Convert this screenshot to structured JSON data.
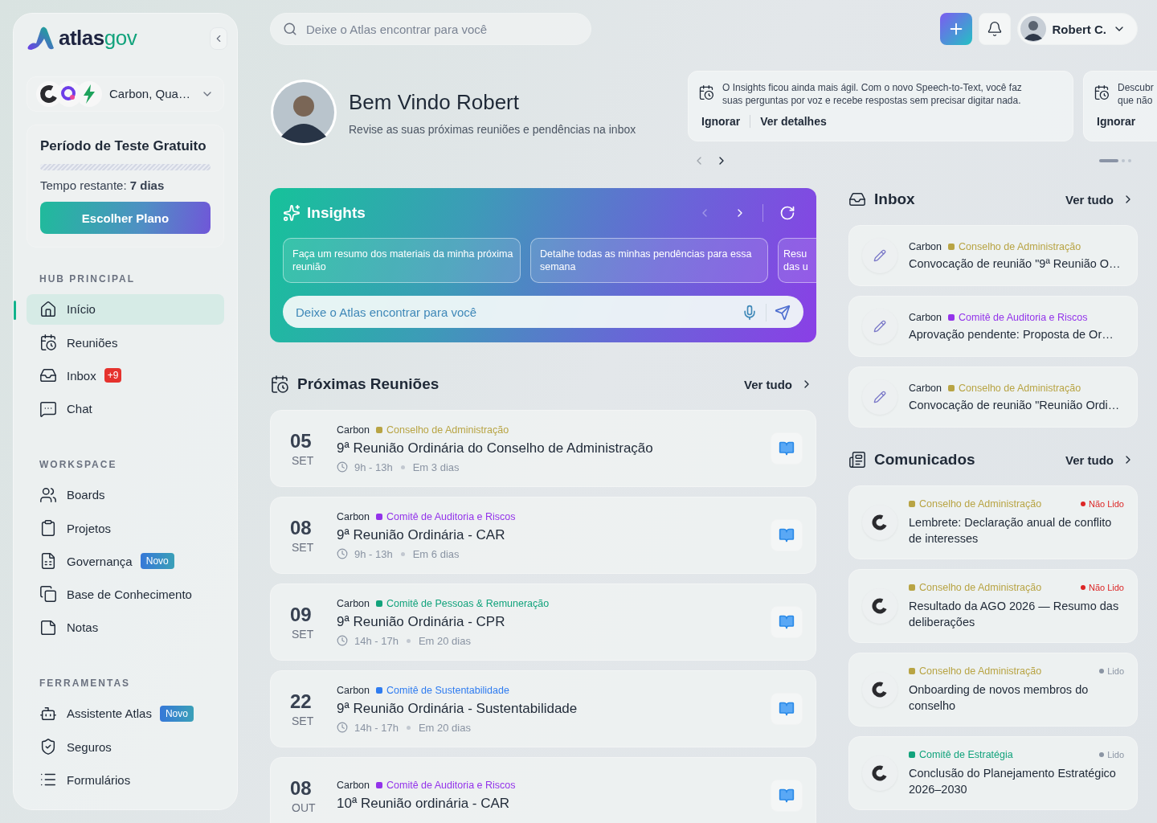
{
  "sidebar": {
    "logo": {
      "part_1": "atlas",
      "part_2": "gov"
    },
    "org_selector": "Carbon, Qua…",
    "trial": {
      "title": "Período de Teste Gratuito",
      "remaining": "Tempo restante: **7 dias**",
      "button": "Escolher Plano"
    },
    "sections": [
      {
        "title": "HUB PRINCIPAL",
        "items": [
          {
            "label": "Início",
            "selected": true
          },
          {
            "label": "Reuniões",
            "selected": false
          },
          {
            "label": "Inbox",
            "selected": false,
            "badge": {
              "text": "+9",
              "kind": "count"
            }
          },
          {
            "label": "Chat",
            "selected": false
          }
        ]
      },
      {
        "title": "WORKSPACE",
        "items": [
          {
            "label": "Boards",
            "selected": false
          },
          {
            "label": "Projetos",
            "selected": false
          },
          {
            "label": "Governança",
            "selected": false,
            "badge": {
              "text": "Novo",
              "kind": "new"
            }
          },
          {
            "label": "Base de Conhecimento",
            "selected": false
          },
          {
            "label": "Notas",
            "selected": false
          }
        ]
      },
      {
        "title": "FERRAMENTAS",
        "items": [
          {
            "label": "Assistente Atlas",
            "selected": false,
            "badge": {
              "text": "Novo",
              "kind": "new"
            }
          },
          {
            "label": "Seguros",
            "selected": false
          },
          {
            "label": "Formulários",
            "selected": false
          }
        ]
      }
    ]
  },
  "topbar": {
    "search_placeholder": "Deixe o Atlas encontrar para você",
    "user": "Robert C."
  },
  "welcome": {
    "title": "Bem Vindo Robert",
    "subtitle": "Revise as suas próximas reuniões e pendências na inbox"
  },
  "announcements": {
    "prev_disabled": true,
    "items": [
      {
        "lines": [
          "O Insights ficou ainda mais ágil. Com o novo Speech-to-Text, você faz",
          "suas perguntas por voz e recebe respostas sem precisar digitar nada."
        ],
        "actions": [
          "Ignorar",
          "Ver detalhes"
        ]
      },
      {
        "lines": [
          "Descubr",
          "que não"
        ],
        "actions": [
          "Ignorar"
        ]
      }
    ],
    "dots": [
      {
        "selected": true
      },
      {
        "selected": false
      },
      {
        "selected": false
      }
    ]
  },
  "insights": {
    "title": "Insights",
    "prev_disabled": true,
    "suggestions": [
      {
        "lines": [
          "Faça um resumo dos materiais da minha próxima",
          "reunião"
        ]
      },
      {
        "lines": [
          "Detalhe todas as minhas pendências para essa",
          "semana"
        ]
      },
      {
        "lines": [
          "Resu",
          "das u"
        ]
      }
    ],
    "placeholder": "Deixe o Atlas encontrar para você"
  },
  "meetings": {
    "title": "Próximas Reuniões",
    "link": "Ver tudo",
    "items": [
      {
        "day": "05",
        "month": "SET",
        "org": "Carbon",
        "committee": "Conselho de Administração",
        "color": "#b8a444",
        "title": "9ª Reunião Ordinária do Conselho de Administração",
        "time": "9h - 13h",
        "due": "Em 3 dias"
      },
      {
        "day": "08",
        "month": "SET",
        "org": "Carbon",
        "committee": "Comitê de Auditoria e Riscos",
        "color": "#9333ea",
        "title": "9ª Reunião Ordinária - CAR",
        "time": "9h - 13h",
        "due": "Em 6 dias"
      },
      {
        "day": "09",
        "month": "SET",
        "org": "Carbon",
        "committee": "Comitê de Pessoas & Remuneração",
        "color": "#12a37c",
        "title": "9ª Reunião Ordinária - CPR",
        "time": "14h - 17h",
        "due": "Em 20 dias"
      },
      {
        "day": "22",
        "month": "SET",
        "org": "Carbon",
        "committee": "Comitê de Sustentabilidade",
        "color": "#2f7cf0",
        "title": "9ª Reunião Ordinária - Sustentabilidade",
        "time": "14h - 17h",
        "due": "Em 20 dias"
      },
      {
        "day": "08",
        "month": "OUT",
        "org": "Carbon",
        "committee": "Comitê de Auditoria e Riscos",
        "color": "#9333ea",
        "title": "10ª Reunião ordinária - CAR"
      }
    ]
  },
  "inbox": {
    "title": "Inbox",
    "link": "Ver tudo",
    "items": [
      {
        "org": "Carbon",
        "committee": "Conselho de Administração",
        "color": "#b8a444",
        "subject": "Convocação de reunião \"9ª Reunião O…"
      },
      {
        "org": "Carbon",
        "committee": "Comitê de Auditoria e Riscos",
        "color": "#9333ea",
        "subject": "Aprovação pendente: Proposta de Or…"
      },
      {
        "org": "Carbon",
        "committee": "Conselho de Administração",
        "color": "#b8a444",
        "subject": "Convocação de reunião \"Reunião Ordi…"
      }
    ]
  },
  "communiques": {
    "title": "Comunicados",
    "link": "Ver tudo",
    "items": [
      {
        "committee": "Conselho de Administração",
        "color": "#b8a444",
        "read": false,
        "status": "Não Lido",
        "title": "Lembrete: Declaração anual de conflito de interesses"
      },
      {
        "committee": "Conselho de Administração",
        "color": "#b8a444",
        "read": false,
        "status": "Não Lido",
        "title": "Resultado da AGO 2026 — Resumo das deliberações"
      },
      {
        "committee": "Conselho de Administração",
        "color": "#b8a444",
        "read": true,
        "status": "Lido",
        "title": "Onboarding de novos membros do conselho"
      },
      {
        "committee": "Comitê de Estratégia",
        "color": "#12a37c",
        "read": true,
        "status": "Lido",
        "title": "Conclusão do Planejamento Estratégico 2026–2030"
      }
    ]
  }
}
